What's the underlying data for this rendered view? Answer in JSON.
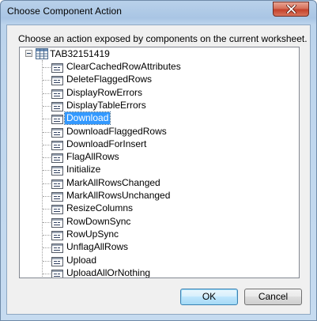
{
  "window": {
    "title": "Choose Component Action"
  },
  "instruction": "Choose an action exposed by components on the current worksheet.",
  "tree": {
    "root": {
      "label": "TAB32151419",
      "expanded": true
    },
    "items": [
      {
        "label": "ClearCachedRowAttributes",
        "selected": false
      },
      {
        "label": "DeleteFlaggedRows",
        "selected": false
      },
      {
        "label": "DisplayRowErrors",
        "selected": false
      },
      {
        "label": "DisplayTableErrors",
        "selected": false
      },
      {
        "label": "Download",
        "selected": true
      },
      {
        "label": "DownloadFlaggedRows",
        "selected": false
      },
      {
        "label": "DownloadForInsert",
        "selected": false
      },
      {
        "label": "FlagAllRows",
        "selected": false
      },
      {
        "label": "Initialize",
        "selected": false
      },
      {
        "label": "MarkAllRowsChanged",
        "selected": false
      },
      {
        "label": "MarkAllRowsUnchanged",
        "selected": false
      },
      {
        "label": "ResizeColumns",
        "selected": false
      },
      {
        "label": "RowDownSync",
        "selected": false
      },
      {
        "label": "RowUpSync",
        "selected": false
      },
      {
        "label": "UnflagAllRows",
        "selected": false
      },
      {
        "label": "Upload",
        "selected": false
      },
      {
        "label": "UploadAllOrNothing",
        "selected": false
      }
    ]
  },
  "buttons": {
    "ok_label": "OK",
    "cancel_label": "Cancel"
  },
  "colors": {
    "selection": "#3399ff",
    "close_button": "#c4412b"
  },
  "icons": {
    "root": "table-icon",
    "item": "action-method-icon",
    "close": "close-icon"
  }
}
